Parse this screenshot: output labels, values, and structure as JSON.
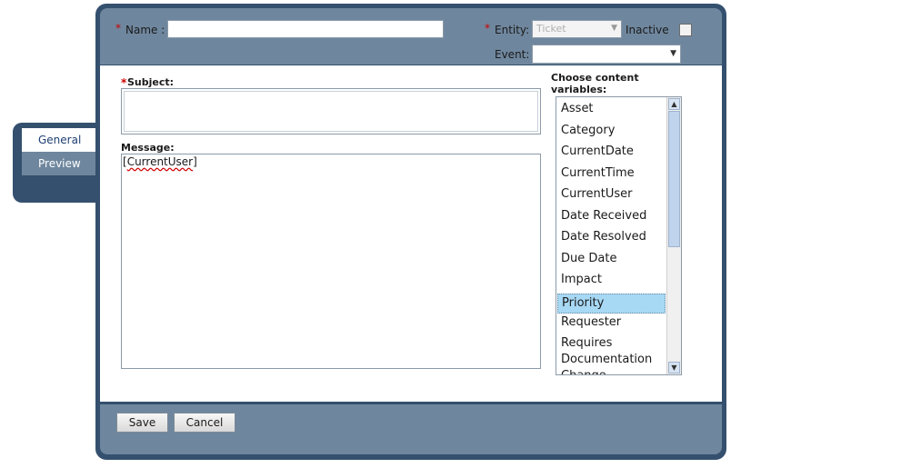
{
  "tabs": [
    {
      "label": "General",
      "active": true
    },
    {
      "label": "Preview",
      "active": false
    }
  ],
  "header": {
    "required_mark": "*",
    "name_label": "Name :",
    "name_value": "",
    "entity_label": "Entity:",
    "entity_value": "Ticket",
    "inactive_label": "Inactive",
    "inactive_checked": false,
    "event_label": "Event:",
    "event_value": ""
  },
  "form": {
    "subject_required": "*",
    "subject_label": "Subject:",
    "subject_value": "",
    "message_label": "Message:",
    "message_value": "[CurrentUser]",
    "message_open": "[",
    "message_word": "CurrentUser",
    "message_close": "]"
  },
  "variables": {
    "label": "Choose content variables:",
    "items": [
      "Asset",
      "Category",
      "CurrentDate",
      "CurrentTime",
      "CurrentUser",
      "Date Received",
      "Date Resolved",
      "Due Date",
      "Impact",
      "Priority",
      "Requester",
      "Requires Documentation",
      "Change"
    ],
    "selected": "Priority"
  },
  "footer": {
    "save_label": "Save",
    "cancel_label": "Cancel"
  },
  "colors": {
    "frame": "#34506e",
    "band": "#6f879e",
    "selected_item": "#a7d8f4",
    "required": "#cc0000"
  }
}
